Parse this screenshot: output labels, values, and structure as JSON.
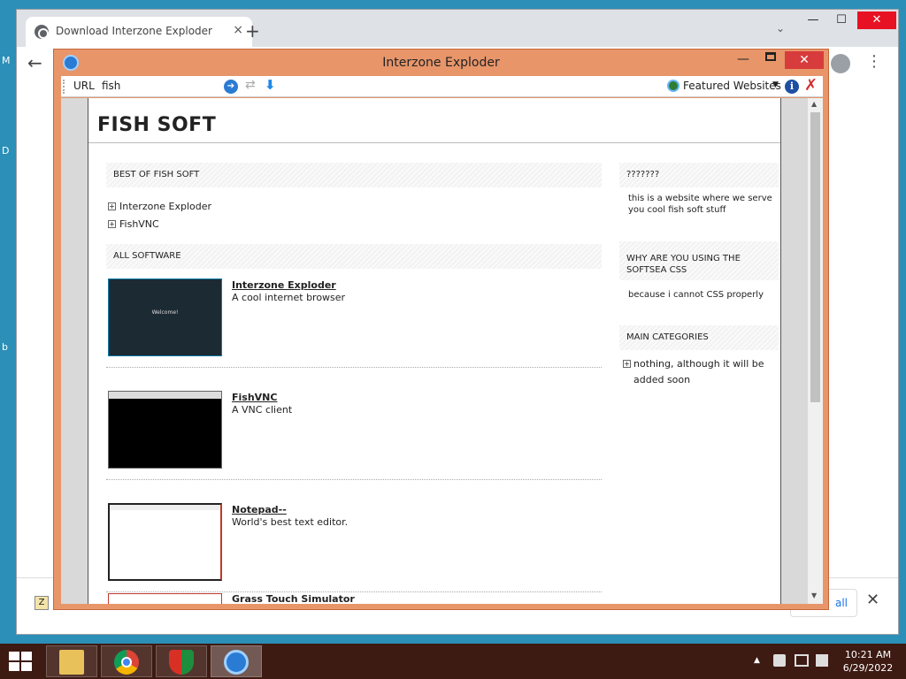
{
  "desktop": {
    "edge_letters": [
      "M",
      "D",
      "b"
    ]
  },
  "chrome": {
    "tab_title": "Download Interzone Exploder",
    "tab_close": "×",
    "new_tab": "+",
    "tab_search": "⌄",
    "min": "—",
    "max": "☐",
    "close": "✕",
    "back": "←",
    "menu": "⋮",
    "download_bar": {
      "show_all": "all",
      "close": "✕",
      "zip": "Z"
    }
  },
  "iz": {
    "title": "Interzone Exploder",
    "min": "—",
    "close": "✕",
    "url_label": "URL",
    "url_value": "fish",
    "go": "➔",
    "refresh": "⇄",
    "download": "⬇",
    "featured": "Featured Websites",
    "featured_arrow": "▼",
    "info": "i",
    "stop": "✗"
  },
  "site": {
    "title": "FISH SOFT",
    "best_header": "BEST OF FISH SOFT",
    "best_items": [
      "Interzone Exploder",
      "FishVNC"
    ],
    "all_header": "ALL SOFTWARE",
    "software": [
      {
        "name": "Interzone Exploder",
        "desc": "A cool internet browser",
        "thumb": "Welcome!"
      },
      {
        "name": "FishVNC",
        "desc": "A VNC client"
      },
      {
        "name": "Notepad--",
        "desc": "World's best text editor."
      },
      {
        "name": "Grass Touch Simulator",
        "desc": ""
      }
    ],
    "side1_header": "???????",
    "side1_text": "this is a website where we serve you cool fish soft stuff",
    "side2_header": "WHY ARE YOU USING THE SOFTSEA CSS",
    "side2_text": "because i cannot CSS properly",
    "side3_header": "MAIN CATEGORIES",
    "side3_item": "nothing, although it will be added soon",
    "expand_glyph": "+"
  },
  "scroll": {
    "up": "▲",
    "down": "▼"
  },
  "taskbar": {
    "apps": [
      "file-explorer",
      "chrome",
      "security-shield",
      "interzone-exploder"
    ],
    "tray_arrow": "▲",
    "time": "10:21 AM",
    "date": "6/29/2022"
  },
  "colors": {
    "iz_frame": "#e8956a",
    "taskbar": "#3d1a12",
    "iz_close": "#d83b3b"
  }
}
